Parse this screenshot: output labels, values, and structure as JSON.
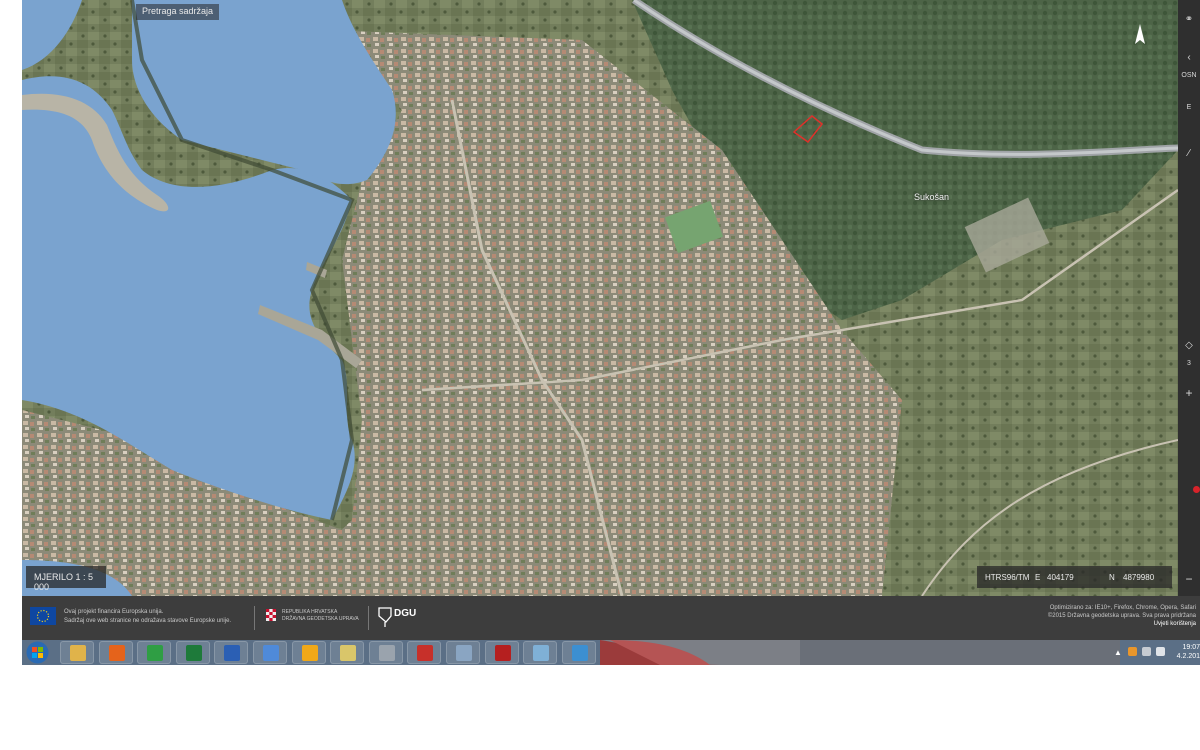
{
  "map": {
    "search_placeholder": "Pretraga sadržaja",
    "place_label": "Sukošan",
    "scale_text": "MJERILO 1 : 5 000",
    "crs": "HTRS96/TM",
    "easting_label": "E",
    "easting": "404179",
    "northing_label": "N",
    "northing": "4879980"
  },
  "right_toolbar": {
    "labels": [
      "OSN",
      "E",
      "3"
    ]
  },
  "footer": {
    "eu_line1": "Ovaj projekt financira Europska unija.",
    "eu_line2": "Sadržaj ove web stranice ne odražava stavove Europske unije.",
    "rh_line1": "REPUBLIKA HRVATSKA",
    "rh_line2": "DRŽAVNA GEODETSKA UPRAVA",
    "dgu": "DGU",
    "optimized": "Optimizirano za: IE10+, Firefox, Chrome, Opera, Safari",
    "copyright": "©2015 Državna geodetska uprava. Sva prava pridržana",
    "terms": "Uvjeti korištenja"
  },
  "taskbar": {
    "apps": [
      {
        "name": "explorer",
        "color": "#e0b34a"
      },
      {
        "name": "firefox",
        "color": "#e5631b"
      },
      {
        "name": "chrome",
        "color": "#2f9e44"
      },
      {
        "name": "excel",
        "color": "#1e7a3a"
      },
      {
        "name": "word",
        "color": "#2b5fb4"
      },
      {
        "name": "cloud",
        "color": "#4f8ad9"
      },
      {
        "name": "app-orange",
        "color": "#f0a818"
      },
      {
        "name": "tools",
        "color": "#d9c66a"
      },
      {
        "name": "scanner",
        "color": "#9aa3ad"
      },
      {
        "name": "acrobat-distiller",
        "color": "#c7302a"
      },
      {
        "name": "calculator",
        "color": "#8aa5c2"
      },
      {
        "name": "adobe-reader",
        "color": "#b51f1f"
      },
      {
        "name": "paint",
        "color": "#7fb0d6"
      },
      {
        "name": "ie-network",
        "color": "#3c8fd1"
      }
    ],
    "clock_time": "19:07",
    "clock_date": "4.2.201"
  }
}
